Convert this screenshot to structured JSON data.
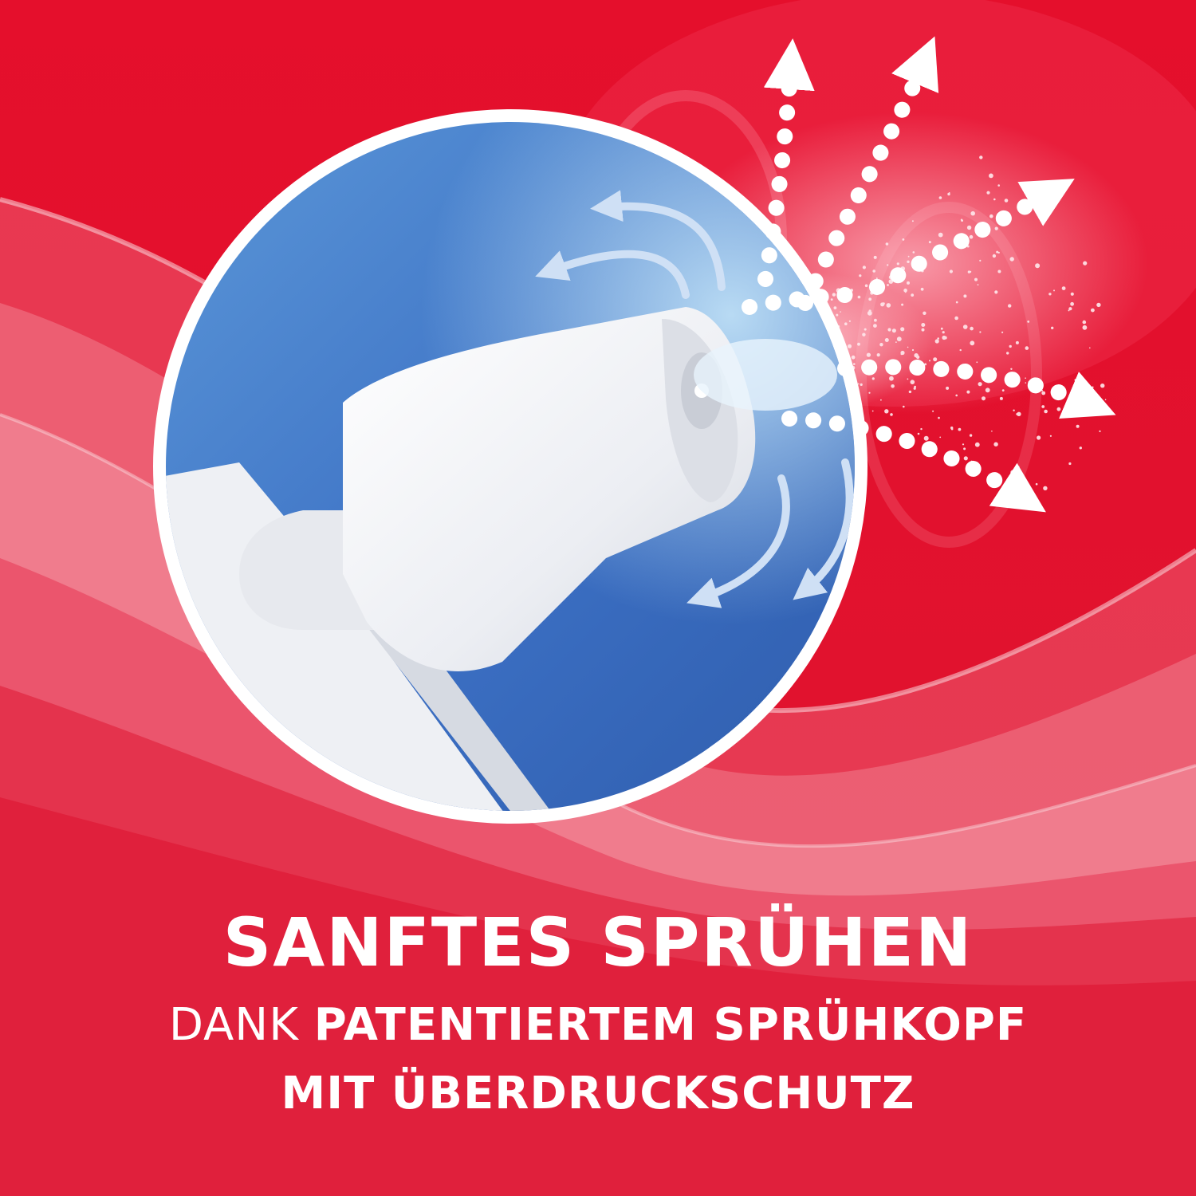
{
  "colors": {
    "background_red": "#e2122d",
    "circle_blue": "#3a6fc2",
    "nozzle_white": "#f1f2f6",
    "text_white": "#ffffff"
  },
  "illustration": {
    "subject": "spray-nozzle",
    "icons": [
      "spray-nozzle-icon",
      "air-flow-arrow-icon",
      "dotted-spray-arrow-icon",
      "spray-mist-icon"
    ]
  },
  "caption": {
    "headline": "SANFTES SPRÜHEN",
    "line2_light": "DANK ",
    "line2_bold": "PATENTIERTEM SPRÜHKOPF",
    "line3": "MIT ÜBERDRUCKSCHUTZ"
  }
}
